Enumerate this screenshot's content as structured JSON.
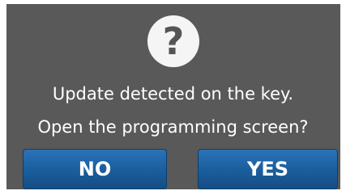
{
  "dialog": {
    "icon": "question-mark-icon",
    "icon_glyph": "?",
    "message_line1": "Update detected on the key.",
    "message_line2": "Open the programming screen?",
    "no_label": "NO",
    "yes_label": "YES"
  },
  "colors": {
    "background": "#595959",
    "button": "#1a5d9c",
    "icon_circle": "#f5f5f5",
    "text": "#ffffff"
  }
}
